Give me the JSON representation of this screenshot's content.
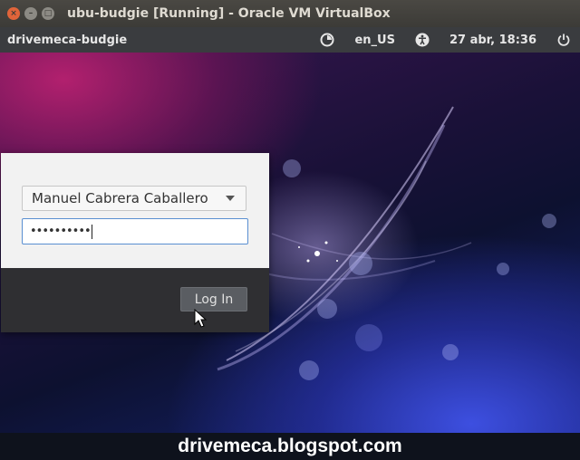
{
  "window": {
    "title": "ubu-budgie [Running] - Oracle VM VirtualBox",
    "buttons": [
      {
        "name": "close",
        "glyph": "×"
      },
      {
        "name": "minimize",
        "glyph": "–"
      },
      {
        "name": "maximize",
        "glyph": "□"
      }
    ]
  },
  "panel": {
    "hostname": "drivemeca-budgie",
    "keyboard_layout": "en_US",
    "datetime": "27 abr, 18:36",
    "icons": [
      "network-icon",
      "accessibility-icon",
      "power-icon"
    ]
  },
  "login": {
    "username": "Manuel Cabrera Caballero",
    "password_mask": "••••••••••",
    "login_button": "Log In"
  },
  "watermark": "drivemeca.blogspot.com",
  "colors": {
    "close_button": "#e0643a",
    "panel_bg": "#3a3c3f",
    "input_focus": "#5a8fd1"
  }
}
